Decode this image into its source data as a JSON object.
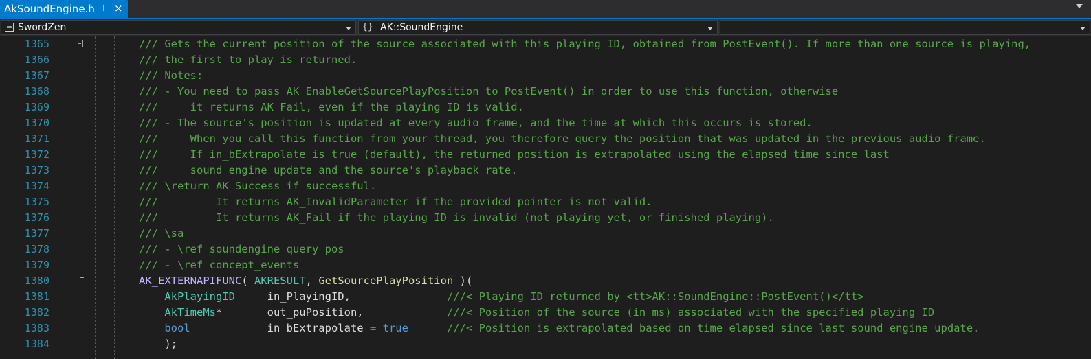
{
  "tab": {
    "title": "AkSoundEngine.h",
    "pin_glyph": "⊣",
    "close_glyph": "×"
  },
  "navbar": {
    "project": "SwordZen",
    "scope_icon": "{}",
    "scope": "AK::SoundEngine",
    "member": ""
  },
  "editor": {
    "lines": [
      {
        "num": "1365",
        "segments": [
          {
            "cls": "cmt",
            "text": "/// Gets the current position of the source associated with this playing ID, obtained from PostEvent(). If more than one source is playing,"
          }
        ]
      },
      {
        "num": "1366",
        "segments": [
          {
            "cls": "cmt",
            "text": "/// the first to play is returned."
          }
        ]
      },
      {
        "num": "1367",
        "segments": [
          {
            "cls": "cmt",
            "text": "/// Notes:"
          }
        ]
      },
      {
        "num": "1368",
        "segments": [
          {
            "cls": "cmt",
            "text": "/// - You need to pass AK_EnableGetSourcePlayPosition to PostEvent() in order to use this function, otherwise"
          }
        ]
      },
      {
        "num": "1369",
        "segments": [
          {
            "cls": "cmt",
            "text": "///     it returns AK_Fail, even if the playing ID is valid."
          }
        ]
      },
      {
        "num": "1370",
        "segments": [
          {
            "cls": "cmt",
            "text": "/// - The source's position is updated at every audio frame, and the time at which this occurs is stored."
          }
        ]
      },
      {
        "num": "1371",
        "segments": [
          {
            "cls": "cmt",
            "text": "///     When you call this function from your thread, you therefore query the position that was updated in the previous audio frame."
          }
        ]
      },
      {
        "num": "1372",
        "segments": [
          {
            "cls": "cmt",
            "text": "///     If in_bExtrapolate is true (default), the returned position is extrapolated using the elapsed time since last"
          }
        ]
      },
      {
        "num": "1373",
        "segments": [
          {
            "cls": "cmt",
            "text": "///     sound engine update and the source's playback rate."
          }
        ]
      },
      {
        "num": "1374",
        "segments": [
          {
            "cls": "cmt",
            "text": "/// \\return AK_Success if successful."
          }
        ]
      },
      {
        "num": "1375",
        "segments": [
          {
            "cls": "cmt",
            "text": "///         It returns AK_InvalidParameter if the provided pointer is not valid."
          }
        ]
      },
      {
        "num": "1376",
        "segments": [
          {
            "cls": "cmt",
            "text": "///         It returns AK_Fail if the playing ID is invalid (not playing yet, or finished playing)."
          }
        ]
      },
      {
        "num": "1377",
        "segments": [
          {
            "cls": "cmt",
            "text": "/// \\sa"
          }
        ]
      },
      {
        "num": "1378",
        "segments": [
          {
            "cls": "cmt",
            "text": "/// - \\ref soundengine_query_pos"
          }
        ]
      },
      {
        "num": "1379",
        "segments": [
          {
            "cls": "cmt",
            "text": "/// - \\ref concept_events"
          }
        ]
      },
      {
        "num": "1380",
        "segments": [
          {
            "cls": "macro",
            "text": "AK_EXTERNAPIFUNC"
          },
          {
            "cls": "plain",
            "text": "( "
          },
          {
            "cls": "type",
            "text": "AKRESULT"
          },
          {
            "cls": "plain",
            "text": ", "
          },
          {
            "cls": "fn",
            "text": "GetSourcePlayPosition"
          },
          {
            "cls": "plain",
            "text": " )("
          }
        ]
      },
      {
        "num": "1381",
        "segments": [
          {
            "cls": "plain",
            "text": "    "
          },
          {
            "cls": "type",
            "text": "AkPlayingID"
          },
          {
            "cls": "plain",
            "text": "     in_PlayingID,               "
          },
          {
            "cls": "cmt",
            "text": "///< Playing ID returned by <tt>AK::SoundEngine::PostEvent()</tt>"
          }
        ]
      },
      {
        "num": "1382",
        "segments": [
          {
            "cls": "plain",
            "text": "    "
          },
          {
            "cls": "type",
            "text": "AkTimeMs"
          },
          {
            "cls": "plain",
            "text": "*       out_puPosition,             "
          },
          {
            "cls": "cmt",
            "text": "///< Position of the source (in ms) associated with the specified playing ID"
          }
        ]
      },
      {
        "num": "1383",
        "segments": [
          {
            "cls": "plain",
            "text": "    "
          },
          {
            "cls": "kw",
            "text": "bool"
          },
          {
            "cls": "plain",
            "text": "            in_bExtrapolate = "
          },
          {
            "cls": "kw",
            "text": "true"
          },
          {
            "cls": "plain",
            "text": "      "
          },
          {
            "cls": "cmt",
            "text": "///< Position is extrapolated based on time elapsed since last sound engine update."
          }
        ]
      },
      {
        "num": "1384",
        "segments": [
          {
            "cls": "plain",
            "text": "    );"
          }
        ]
      }
    ]
  }
}
